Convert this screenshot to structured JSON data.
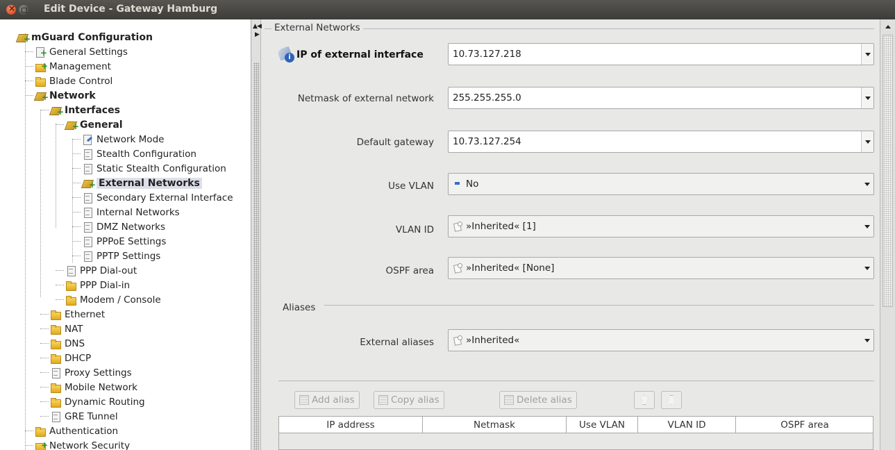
{
  "window": {
    "title": "Edit Device - Gateway Hamburg"
  },
  "tree": {
    "items": [
      {
        "label": "mGuard Configuration",
        "icon": "tool-icon",
        "bold": true
      },
      {
        "label": "General Settings",
        "icon": "doc-plus-icon"
      },
      {
        "label": "Management",
        "icon": "folder-plus-icon"
      },
      {
        "label": "Blade Control",
        "icon": "folder-icon"
      },
      {
        "label": "Network",
        "icon": "tool-icon",
        "bold": true
      },
      {
        "label": "Interfaces",
        "icon": "tool-icon",
        "bold": true
      },
      {
        "label": "General",
        "icon": "tool-icon",
        "bold": true
      },
      {
        "label": "Network Mode",
        "icon": "doc-edit-icon"
      },
      {
        "label": "Stealth Configuration",
        "icon": "doc-icon"
      },
      {
        "label": "Static Stealth Configuration",
        "icon": "doc-icon"
      },
      {
        "label": "External Networks",
        "icon": "tool-icon",
        "bold": true,
        "selected": true
      },
      {
        "label": "Secondary External Interface",
        "icon": "doc-icon"
      },
      {
        "label": "Internal Networks",
        "icon": "doc-icon"
      },
      {
        "label": "DMZ Networks",
        "icon": "doc-icon"
      },
      {
        "label": "PPPoE Settings",
        "icon": "doc-icon"
      },
      {
        "label": "PPTP Settings",
        "icon": "doc-icon"
      },
      {
        "label": "PPP Dial-out",
        "icon": "doc-icon"
      },
      {
        "label": "PPP Dial-in",
        "icon": "folder-icon"
      },
      {
        "label": "Modem / Console",
        "icon": "folder-icon"
      },
      {
        "label": "Ethernet",
        "icon": "folder-icon"
      },
      {
        "label": "NAT",
        "icon": "folder-icon"
      },
      {
        "label": "DNS",
        "icon": "folder-icon"
      },
      {
        "label": "DHCP",
        "icon": "folder-icon"
      },
      {
        "label": "Proxy Settings",
        "icon": "doc-icon"
      },
      {
        "label": "Mobile Network",
        "icon": "folder-icon"
      },
      {
        "label": "Dynamic Routing",
        "icon": "folder-icon"
      },
      {
        "label": "GRE Tunnel",
        "icon": "doc-icon"
      },
      {
        "label": "Authentication",
        "icon": "folder-icon"
      },
      {
        "label": "Network Security",
        "icon": "folder-plus-icon"
      }
    ]
  },
  "external_networks": {
    "section_title": "External Networks",
    "ip_label": "IP of external interface",
    "ip_value": "10.73.127.218",
    "netmask_label": "Netmask of external network",
    "netmask_value": "255.255.255.0",
    "gateway_label": "Default gateway",
    "gateway_value": "10.73.127.254",
    "vlan_label": "Use VLAN",
    "vlan_value": "No",
    "vlan_id_label": "VLAN ID",
    "vlan_id_value": "»Inherited« [1]",
    "ospf_label": "OSPF area",
    "ospf_value": "»Inherited« [None]"
  },
  "aliases": {
    "section_title": "Aliases",
    "external_aliases_label": "External aliases",
    "external_aliases_value": "»Inherited«",
    "buttons": {
      "add": "Add alias",
      "copy": "Copy alias",
      "delete": "Delete alias"
    },
    "table_headers": [
      "IP address",
      "Netmask",
      "Use VLAN",
      "VLAN ID",
      "OSPF area"
    ]
  }
}
